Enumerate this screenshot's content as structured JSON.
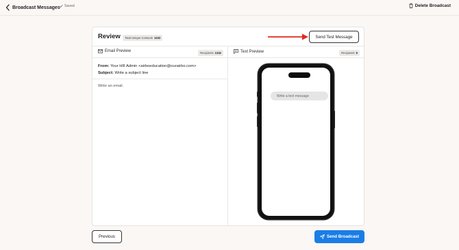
{
  "header": {
    "title": "Broadcast Messages",
    "saved_label": "Saved",
    "delete_label": "Delete Broadcast"
  },
  "review": {
    "title": "Review",
    "total_unique_contacts_label": "Total Unique Contacts",
    "total_unique_contacts_value": "1332",
    "send_test_label": "Send Test Message"
  },
  "email_preview": {
    "title": "Email Preview",
    "recipients_label": "Recipients",
    "recipients_value": "1332",
    "from_label": "From:",
    "from_value": "Your HR Admin <airboeducation@ourairbo.com>",
    "subject_label": "Subject:",
    "subject_value": "Write a subject line",
    "body_placeholder": "Write an email."
  },
  "text_preview": {
    "title": "Text Preview",
    "recipients_label": "Recipients",
    "recipients_value": "5",
    "message_placeholder": "Write a text message"
  },
  "footer": {
    "previous_label": "Previous",
    "send_broadcast_label": "Send Broadcast"
  },
  "colors": {
    "accent": "#1a7de6",
    "annotation_arrow": "#e02a1d",
    "background": "#faf7f5"
  },
  "icons": {
    "back": "chevron-left-icon",
    "saved": "check-icon",
    "delete": "trash-icon",
    "email": "envelope-icon",
    "text": "message-icon",
    "send": "paper-plane-icon"
  }
}
